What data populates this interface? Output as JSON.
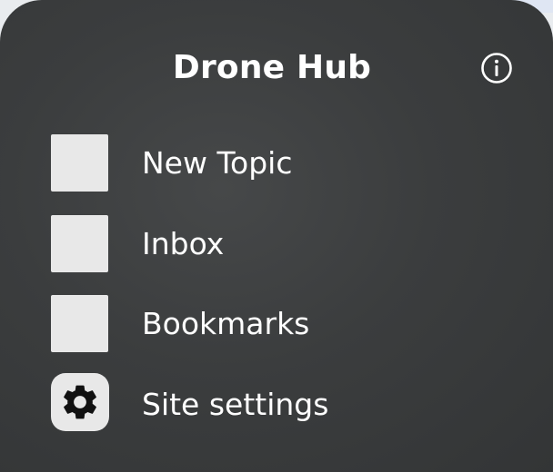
{
  "sheet": {
    "title": "Drone Hub",
    "info_icon": "info-circle-icon"
  },
  "menu": {
    "items": [
      {
        "label": "New Topic",
        "icon": "placeholder-square-icon"
      },
      {
        "label": "Inbox",
        "icon": "placeholder-square-icon"
      },
      {
        "label": "Bookmarks",
        "icon": "placeholder-square-icon"
      },
      {
        "label": "Site settings",
        "icon": "gear-icon"
      }
    ]
  },
  "colors": {
    "sheet_background": "#3b3d3e",
    "text": "#ffffff",
    "icon_tile": "#e8e8e8"
  }
}
